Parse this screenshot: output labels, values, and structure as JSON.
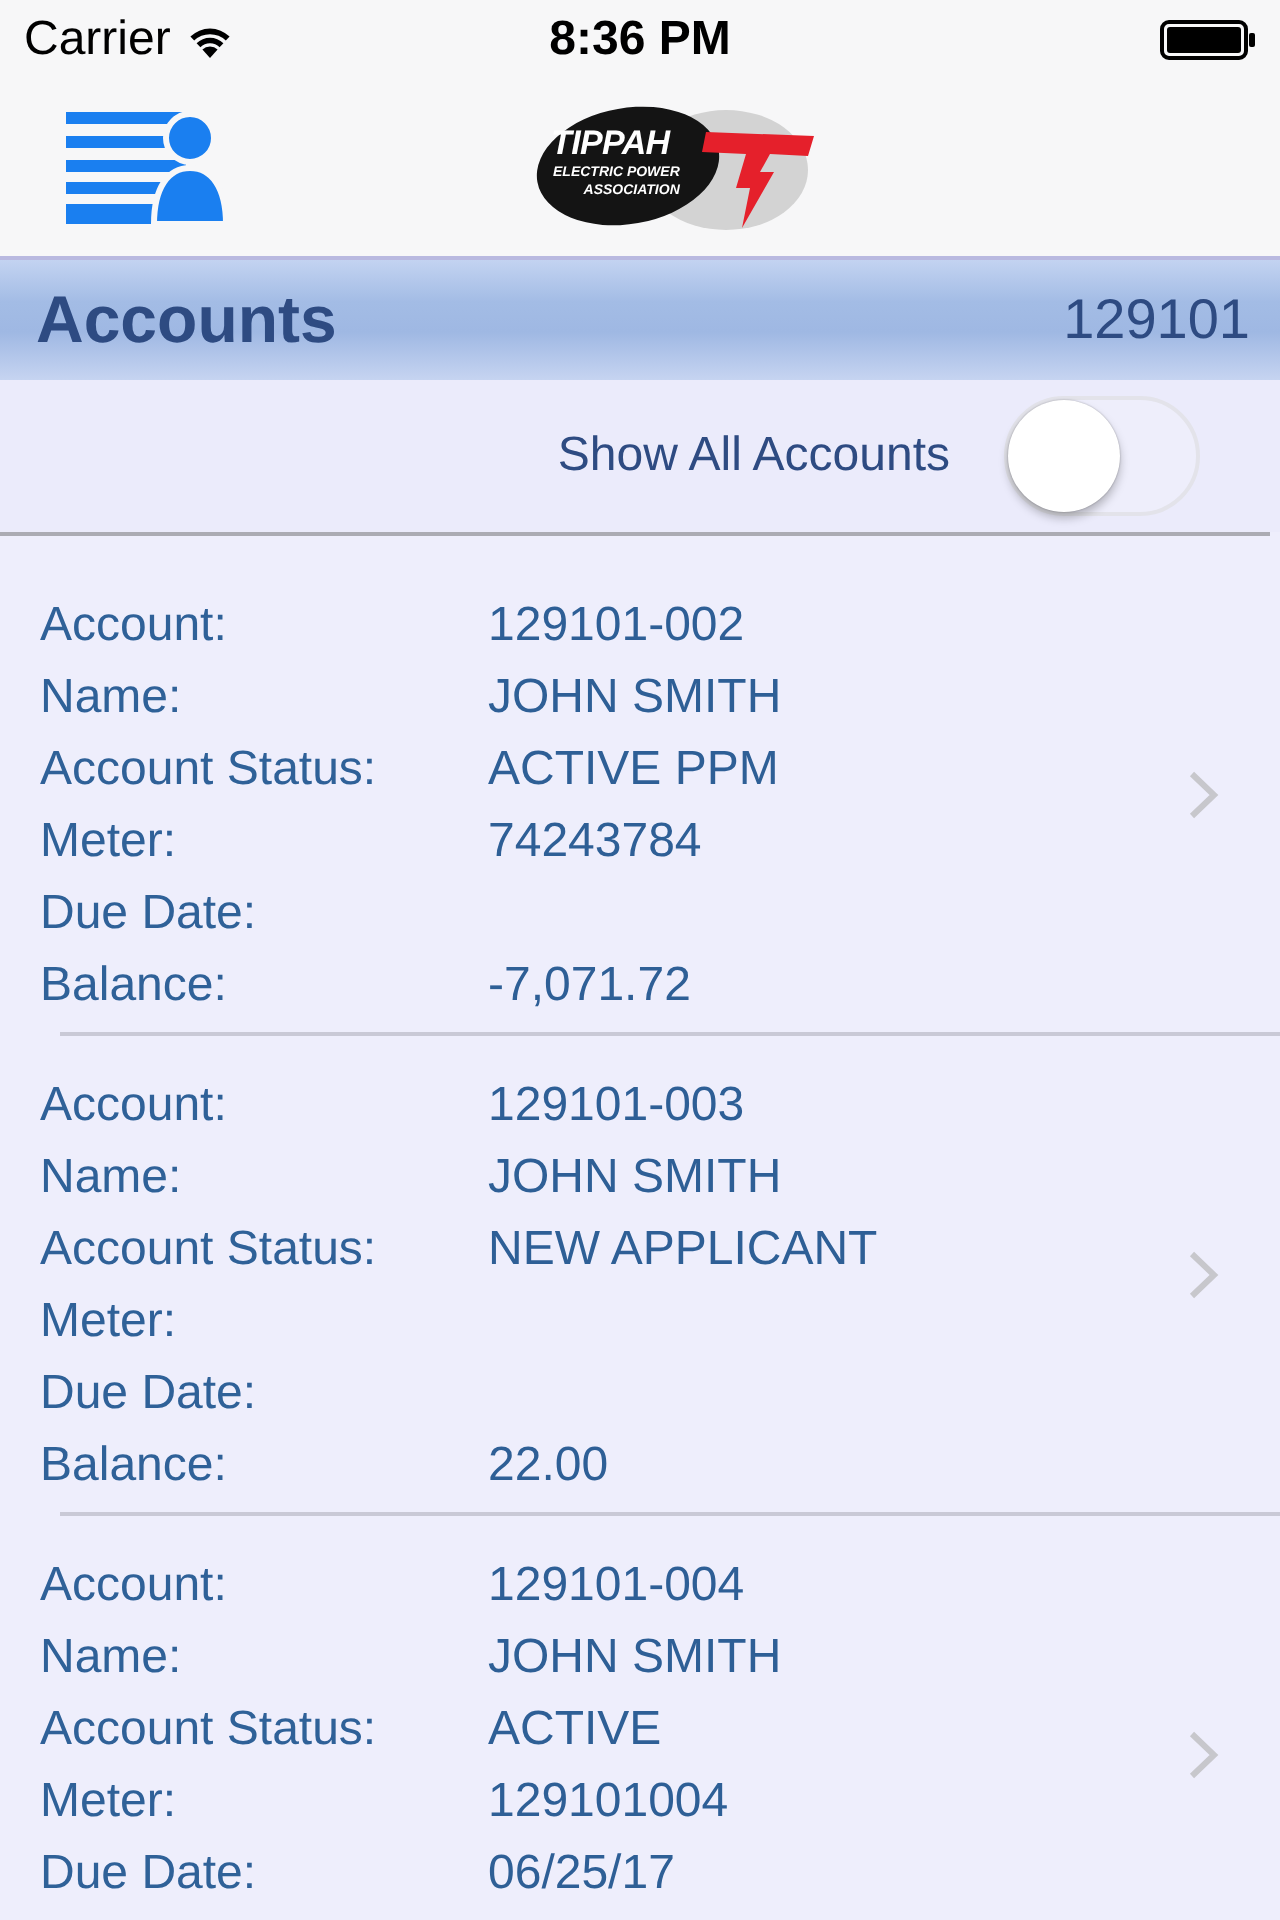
{
  "status_bar": {
    "carrier": "Carrier",
    "time": "8:36 PM"
  },
  "nav_bar": {
    "logo": {
      "title": "TIPPAH",
      "subtitle_lines": [
        "ELECTRIC POWER",
        "ASSOCIATION"
      ]
    }
  },
  "header": {
    "title": "Accounts",
    "account_number": "129101"
  },
  "toggle": {
    "label": "Show All Accounts",
    "on": false
  },
  "accounts": [
    {
      "fields": [
        {
          "label": "Account:",
          "value": "129101-002"
        },
        {
          "label": "Name:",
          "value": "JOHN SMITH"
        },
        {
          "label": "Account Status:",
          "value": "ACTIVE PPM"
        },
        {
          "label": "Meter:",
          "value": "74243784"
        },
        {
          "label": "Due Date:"
        },
        {
          "label": "Balance:",
          "value": "-7,071.72"
        }
      ]
    },
    {
      "fields": [
        {
          "label": "Account:",
          "value": "129101-003"
        },
        {
          "label": "Name:",
          "value": "JOHN SMITH"
        },
        {
          "label": "Account Status:",
          "value": "NEW APPLICANT"
        },
        {
          "label": "Meter:"
        },
        {
          "label": "Due Date:"
        },
        {
          "label": "Balance:",
          "value": "22.00"
        }
      ]
    },
    {
      "fields": [
        {
          "label": "Account:",
          "value": "129101-004"
        },
        {
          "label": "Name:",
          "value": "JOHN SMITH"
        },
        {
          "label": "Account Status:",
          "value": "ACTIVE"
        },
        {
          "label": "Meter:",
          "value": "129101004"
        },
        {
          "label": "Due Date:",
          "value": "06/25/17"
        }
      ]
    }
  ]
}
